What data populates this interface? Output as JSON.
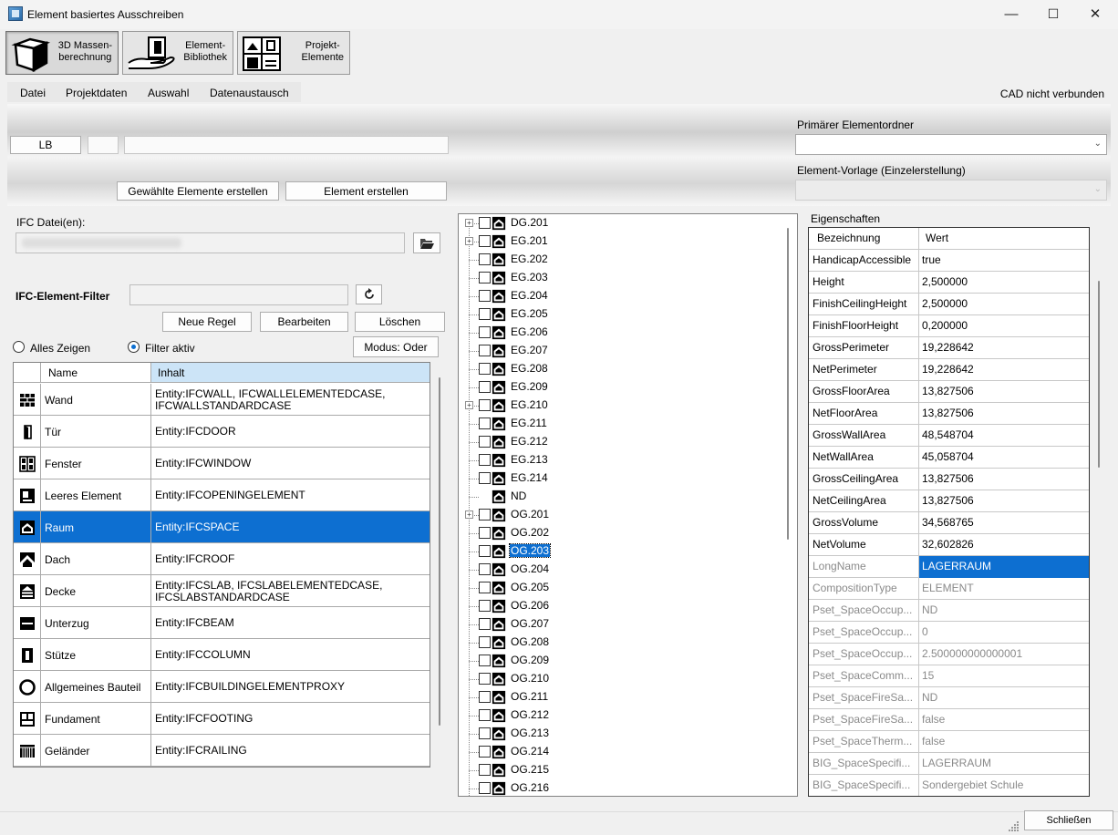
{
  "window": {
    "title": "Element basiertes Ausschreiben",
    "minimize_glyph": "—",
    "maximize_glyph": "☐",
    "close_glyph": "✕"
  },
  "toolbar": {
    "buttons": [
      {
        "label": "3D Massen-\nberechnung",
        "icon": "cube-icon",
        "active": true
      },
      {
        "label": "Element-\nBibliothek",
        "icon": "hand-book-icon",
        "active": false
      },
      {
        "label": "Projekt-\nElemente",
        "icon": "window-door-icon",
        "active": false
      }
    ]
  },
  "menu": {
    "items": [
      "Datei",
      "Projektdaten",
      "Auswahl",
      "Datenaustausch"
    ],
    "cad_status": "CAD nicht verbunden"
  },
  "lb": {
    "button_label": "LB",
    "field_value": "",
    "description_value": ""
  },
  "create": {
    "selected_label": "Gewählte Elemente erstellen",
    "single_label": "Element erstellen"
  },
  "primary_folder": {
    "label": "Primärer Elementordner",
    "value": ""
  },
  "template": {
    "label": "Element-Vorlage (Einzelerstellung)",
    "value": ""
  },
  "ifc": {
    "label": "IFC Datei(en):",
    "value": "",
    "browse_icon": "folder-open-icon"
  },
  "filter": {
    "label": "IFC-Element-Filter",
    "value": "",
    "reset_icon": "refresh-icon",
    "new_rule_label": "Neue Regel",
    "edit_label": "Bearbeiten",
    "delete_label": "Löschen",
    "show_all_label": "Alles Zeigen",
    "filter_active_label": "Filter aktiv",
    "mode_label": "Modus: Oder",
    "table": {
      "col_name": "Name",
      "col_content": "Inhalt",
      "rows": [
        {
          "icon": "wall-icon",
          "name": "Wand",
          "content": "Entity:IFCWALL, IFCWALLELEMENTEDCASE,\nIFCWALLSTANDARDCASE"
        },
        {
          "icon": "door-icon",
          "name": "Tür",
          "content": "Entity:IFCDOOR"
        },
        {
          "icon": "window-icon",
          "name": "Fenster",
          "content": "Entity:IFCWINDOW"
        },
        {
          "icon": "opening-icon",
          "name": "Leeres Element",
          "content": "Entity:IFCOPENINGELEMENT"
        },
        {
          "icon": "room-icon",
          "name": "Raum",
          "content": "Entity:IFCSPACE",
          "selected": true
        },
        {
          "icon": "roof-icon",
          "name": "Dach",
          "content": "Entity:IFCROOF"
        },
        {
          "icon": "slab-icon",
          "name": "Decke",
          "content": "Entity:IFCSLAB, IFCSLABELEMENTEDCASE,\nIFCSLABSTANDARDCASE"
        },
        {
          "icon": "beam-icon",
          "name": "Unterzug",
          "content": "Entity:IFCBEAM"
        },
        {
          "icon": "column-icon",
          "name": "Stütze",
          "content": "Entity:IFCCOLUMN"
        },
        {
          "icon": "proxy-icon",
          "name": "Allgemeines Bauteil",
          "content": "Entity:IFCBUILDINGELEMENTPROXY"
        },
        {
          "icon": "footing-icon",
          "name": "Fundament",
          "content": "Entity:IFCFOOTING"
        },
        {
          "icon": "railing-icon",
          "name": "Geländer",
          "content": "Entity:IFCRAILING"
        }
      ]
    }
  },
  "tree": {
    "expander_glyph": "+",
    "items": [
      {
        "name": "DG.201",
        "expandable": true
      },
      {
        "name": "EG.201",
        "expandable": true
      },
      {
        "name": "EG.202"
      },
      {
        "name": "EG.203"
      },
      {
        "name": "EG.204"
      },
      {
        "name": "EG.205"
      },
      {
        "name": "EG.206"
      },
      {
        "name": "EG.207"
      },
      {
        "name": "EG.208"
      },
      {
        "name": "EG.209"
      },
      {
        "name": "EG.210",
        "expandable": true
      },
      {
        "name": "EG.211"
      },
      {
        "name": "EG.212"
      },
      {
        "name": "EG.213"
      },
      {
        "name": "EG.214"
      },
      {
        "name": "ND",
        "nocheck": true
      },
      {
        "name": "OG.201",
        "expandable": true
      },
      {
        "name": "OG.202"
      },
      {
        "name": "OG.203",
        "selected": true
      },
      {
        "name": "OG.204"
      },
      {
        "name": "OG.205"
      },
      {
        "name": "OG.206"
      },
      {
        "name": "OG.207"
      },
      {
        "name": "OG.208"
      },
      {
        "name": "OG.209"
      },
      {
        "name": "OG.210"
      },
      {
        "name": "OG.211"
      },
      {
        "name": "OG.212"
      },
      {
        "name": "OG.213"
      },
      {
        "name": "OG.214"
      },
      {
        "name": "OG.215"
      },
      {
        "name": "OG.216"
      }
    ]
  },
  "properties": {
    "label": "Eigenschaften",
    "col_name": "Bezeichnung",
    "col_value": "Wert",
    "rows": [
      {
        "k": "HandicapAccessible",
        "v": "true"
      },
      {
        "k": "Height",
        "v": "2,500000"
      },
      {
        "k": "FinishCeilingHeight",
        "v": "2,500000"
      },
      {
        "k": "FinishFloorHeight",
        "v": "0,200000"
      },
      {
        "k": "GrossPerimeter",
        "v": "19,228642"
      },
      {
        "k": "NetPerimeter",
        "v": "19,228642"
      },
      {
        "k": "GrossFloorArea",
        "v": "13,827506"
      },
      {
        "k": "NetFloorArea",
        "v": "13,827506"
      },
      {
        "k": "GrossWallArea",
        "v": "48,548704"
      },
      {
        "k": "NetWallArea",
        "v": "45,058704"
      },
      {
        "k": "GrossCeilingArea",
        "v": "13,827506"
      },
      {
        "k": "NetCeilingArea",
        "v": "13,827506"
      },
      {
        "k": "GrossVolume",
        "v": "34,568765"
      },
      {
        "k": "NetVolume",
        "v": "32,602826"
      },
      {
        "k": "LongName",
        "v": "LAGERRAUM",
        "grey": true,
        "selected": true
      },
      {
        "k": "CompositionType",
        "v": "ELEMENT",
        "grey": true
      },
      {
        "k": "Pset_SpaceOccup...",
        "v": "ND",
        "grey": true
      },
      {
        "k": "Pset_SpaceOccup...",
        "v": "0",
        "grey": true
      },
      {
        "k": "Pset_SpaceOccup...",
        "v": "2.500000000000001",
        "grey": true
      },
      {
        "k": "Pset_SpaceComm...",
        "v": "15",
        "grey": true
      },
      {
        "k": "Pset_SpaceFireSa...",
        "v": "ND",
        "grey": true
      },
      {
        "k": "Pset_SpaceFireSa...",
        "v": "false",
        "grey": true
      },
      {
        "k": "Pset_SpaceTherm...",
        "v": "false",
        "grey": true
      },
      {
        "k": "BIG_SpaceSpecifi...",
        "v": "LAGERRAUM",
        "grey": true
      },
      {
        "k": "BIG_SpaceSpecifi...",
        "v": "Sondergebiet Schule",
        "grey": true
      }
    ]
  },
  "footer": {
    "close_label": "Schließen"
  },
  "colors": {
    "selection": "#0d6fd1",
    "header_selected": "#cce4f7"
  }
}
